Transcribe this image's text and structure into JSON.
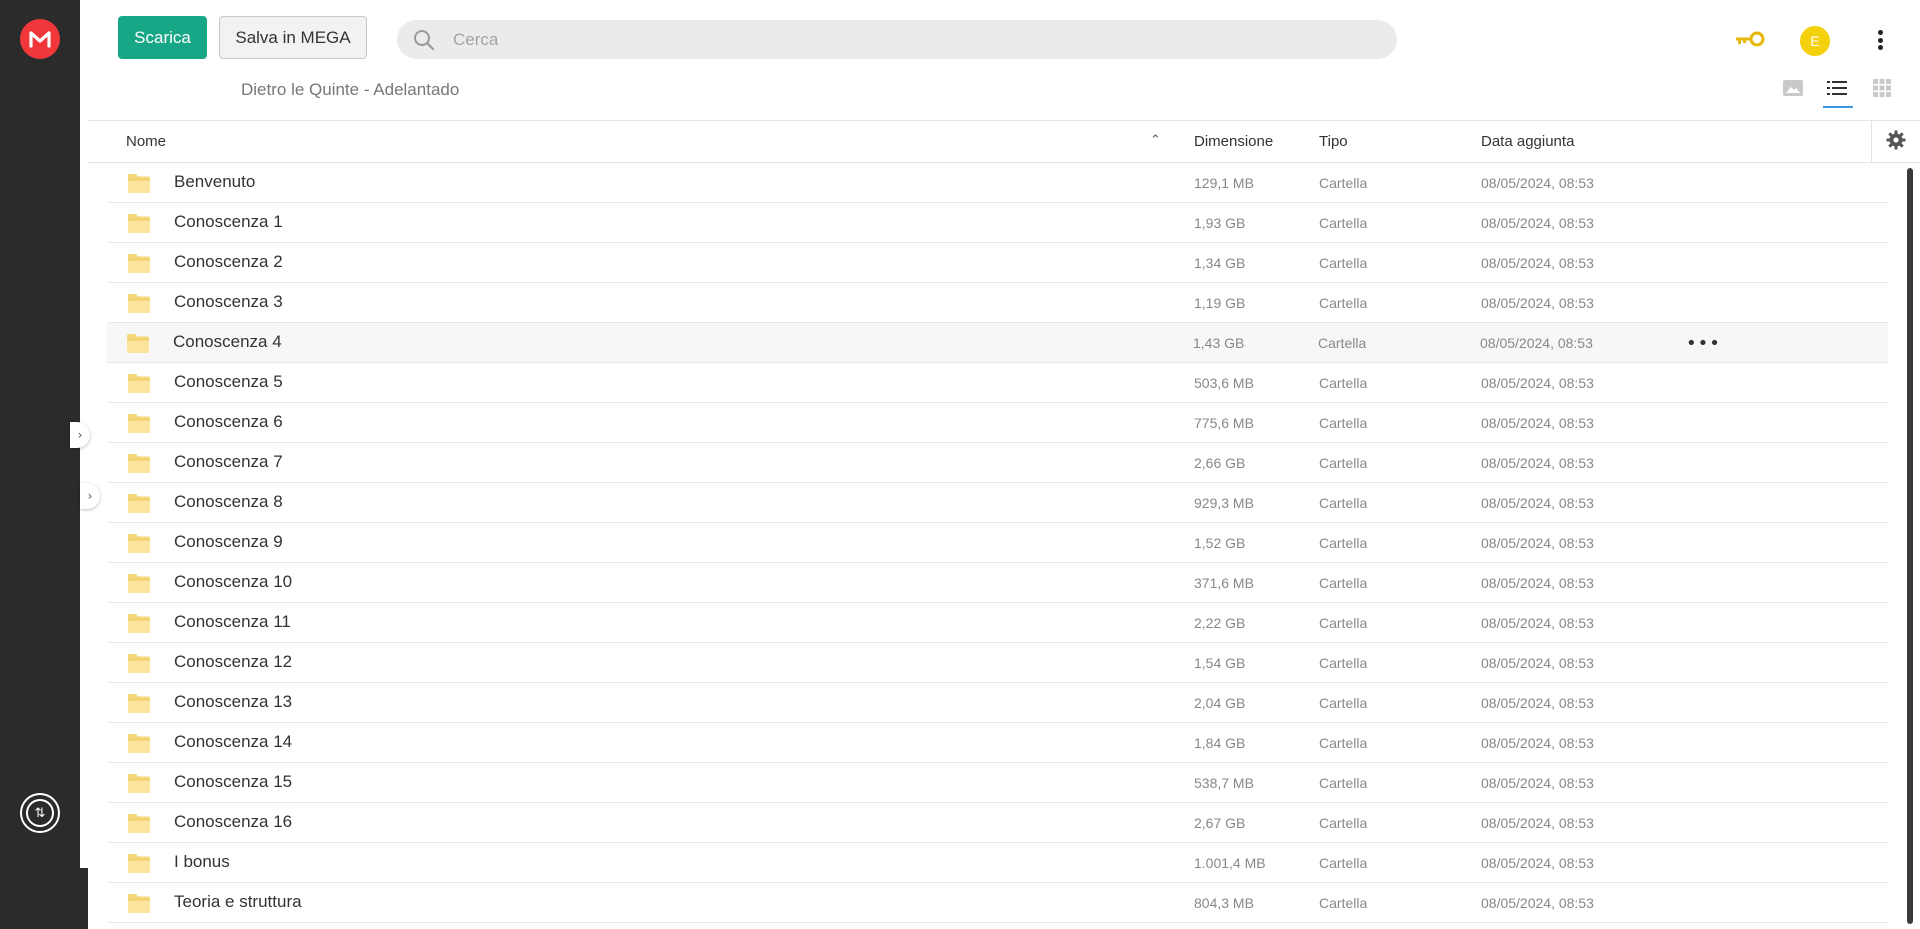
{
  "app": {
    "brand_color": "#f0373a",
    "accent": "#18a786"
  },
  "toolbar": {
    "download_label": "Scarica",
    "save_label": "Salva in MEGA"
  },
  "search": {
    "placeholder": "Cerca",
    "value": ""
  },
  "account": {
    "avatar_initial": "E"
  },
  "breadcrumb": "Dietro le Quinte - Adelantado",
  "view": {
    "modes": [
      "thumbnail-icon",
      "list-icon",
      "grid-icon"
    ],
    "active": "list"
  },
  "table": {
    "headers": {
      "name": "Nome",
      "size": "Dimensione",
      "type": "Tipo",
      "date": "Data aggiunta"
    },
    "sort": {
      "column": "name",
      "direction": "asc"
    },
    "rows": [
      {
        "name": "Benvenuto",
        "size": "129,1 MB",
        "type": "Cartella",
        "date": "08/05/2024, 08:53"
      },
      {
        "name": "Conoscenza 1",
        "size": "1,93 GB",
        "type": "Cartella",
        "date": "08/05/2024, 08:53"
      },
      {
        "name": "Conoscenza 2",
        "size": "1,34 GB",
        "type": "Cartella",
        "date": "08/05/2024, 08:53"
      },
      {
        "name": "Conoscenza 3",
        "size": "1,19 GB",
        "type": "Cartella",
        "date": "08/05/2024, 08:53"
      },
      {
        "name": "Conoscenza 4",
        "size": "1,43 GB",
        "type": "Cartella",
        "date": "08/05/2024, 08:53"
      },
      {
        "name": "Conoscenza 5",
        "size": "503,6 MB",
        "type": "Cartella",
        "date": "08/05/2024, 08:53"
      },
      {
        "name": "Conoscenza 6",
        "size": "775,6 MB",
        "type": "Cartella",
        "date": "08/05/2024, 08:53"
      },
      {
        "name": "Conoscenza 7",
        "size": "2,66 GB",
        "type": "Cartella",
        "date": "08/05/2024, 08:53"
      },
      {
        "name": "Conoscenza 8",
        "size": "929,3 MB",
        "type": "Cartella",
        "date": "08/05/2024, 08:53"
      },
      {
        "name": "Conoscenza 9",
        "size": "1,52 GB",
        "type": "Cartella",
        "date": "08/05/2024, 08:53"
      },
      {
        "name": "Conoscenza 10",
        "size": "371,6 MB",
        "type": "Cartella",
        "date": "08/05/2024, 08:53"
      },
      {
        "name": "Conoscenza 11",
        "size": "2,22 GB",
        "type": "Cartella",
        "date": "08/05/2024, 08:53"
      },
      {
        "name": "Conoscenza 12",
        "size": "1,54 GB",
        "type": "Cartella",
        "date": "08/05/2024, 08:53"
      },
      {
        "name": "Conoscenza 13",
        "size": "2,04 GB",
        "type": "Cartella",
        "date": "08/05/2024, 08:53"
      },
      {
        "name": "Conoscenza 14",
        "size": "1,84 GB",
        "type": "Cartella",
        "date": "08/05/2024, 08:53"
      },
      {
        "name": "Conoscenza 15",
        "size": "538,7 MB",
        "type": "Cartella",
        "date": "08/05/2024, 08:53"
      },
      {
        "name": "Conoscenza 16",
        "size": "2,67 GB",
        "type": "Cartella",
        "date": "08/05/2024, 08:53"
      },
      {
        "name": "I bonus",
        "size": "1.001,4 MB",
        "type": "Cartella",
        "date": "08/05/2024, 08:53"
      },
      {
        "name": "Teoria e struttura",
        "size": "804,3 MB",
        "type": "Cartella",
        "date": "08/05/2024, 08:53"
      }
    ],
    "hover_row_index": 4
  }
}
